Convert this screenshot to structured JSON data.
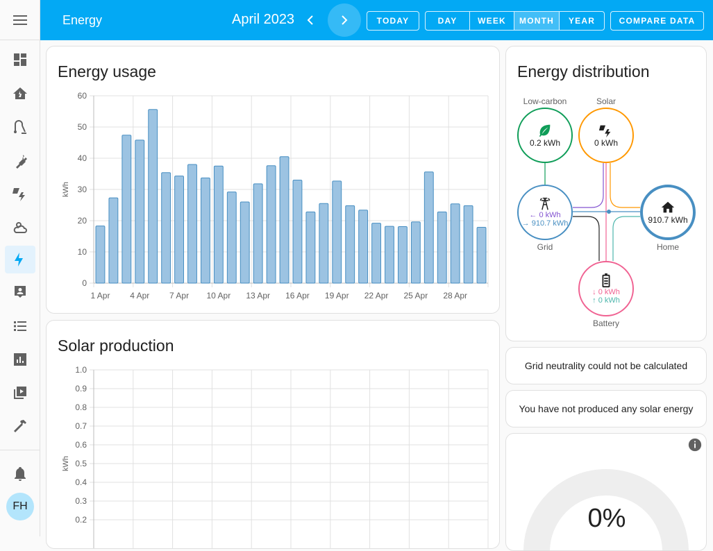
{
  "topbar": {
    "title": "Energy",
    "period": "April 2023",
    "today_label": "TODAY",
    "ranges": [
      "DAY",
      "WEEK",
      "MONTH",
      "YEAR"
    ],
    "selected_range": "MONTH",
    "compare_label": "COMPARE DATA"
  },
  "sidebar": {
    "items": [
      "menu-icon",
      "dashboard-icon",
      "home-lightning-icon",
      "vacuum-icon",
      "plug-icon",
      "solar-power-icon",
      "weather-icon",
      "energy-icon",
      "person-card-icon",
      "list-icon",
      "chart-icon",
      "media-icon",
      "hammer-icon",
      "bell-icon"
    ],
    "active": "energy-icon",
    "avatar": "FH"
  },
  "energy_usage": {
    "title": "Energy usage"
  },
  "solar_production": {
    "title": "Solar production"
  },
  "distribution": {
    "title": "Energy distribution",
    "low_carbon": {
      "label": "Low-carbon",
      "value": "0.2 kWh"
    },
    "solar": {
      "label": "Solar",
      "value": "0 kWh"
    },
    "grid": {
      "label": "Grid",
      "out": "0 kWh",
      "in": "910.7 kWh"
    },
    "home": {
      "label": "Home",
      "value": "910.7 kWh"
    },
    "battery": {
      "label": "Battery",
      "out": "0 kWh",
      "in": "0 kWh"
    },
    "colors": {
      "low_carbon": "#0f9d58",
      "solar": "#ff9800",
      "grid": "#488fc2",
      "home": "#488fc2",
      "battery": "#f06292",
      "return": "#8353d1",
      "battery_in": "#4db6ac"
    }
  },
  "grid_neutrality": {
    "text": "Grid neutrality could not be calculated"
  },
  "solar_message": {
    "text": "You have not produced any solar energy"
  },
  "gauge": {
    "value_text": "0%",
    "value": 0
  },
  "chart_data": [
    {
      "type": "bar",
      "title": "Energy usage",
      "ylabel": "kWh",
      "ylim": [
        0,
        60
      ],
      "yticks": [
        0,
        10,
        20,
        30,
        40,
        50,
        60
      ],
      "x": [
        "1 Apr",
        "2 Apr",
        "3 Apr",
        "4 Apr",
        "5 Apr",
        "6 Apr",
        "7 Apr",
        "8 Apr",
        "9 Apr",
        "10 Apr",
        "11 Apr",
        "12 Apr",
        "13 Apr",
        "14 Apr",
        "15 Apr",
        "16 Apr",
        "17 Apr",
        "18 Apr",
        "19 Apr",
        "20 Apr",
        "21 Apr",
        "22 Apr",
        "23 Apr",
        "24 Apr",
        "25 Apr",
        "26 Apr",
        "27 Apr",
        "28 Apr",
        "29 Apr",
        "30 Apr"
      ],
      "xtick_labels": [
        "1 Apr",
        "4 Apr",
        "7 Apr",
        "10 Apr",
        "13 Apr",
        "16 Apr",
        "19 Apr",
        "22 Apr",
        "25 Apr",
        "28 Apr"
      ],
      "values": [
        18.3,
        27.3,
        47.4,
        45.8,
        55.6,
        35.4,
        34.3,
        38.0,
        33.7,
        37.5,
        29.2,
        26.0,
        31.8,
        37.6,
        40.5,
        33.0,
        22.8,
        25.5,
        32.7,
        24.8,
        23.4,
        19.2,
        18.2,
        18.1,
        19.6,
        35.6,
        22.8,
        25.4,
        24.8,
        17.9
      ],
      "color": "#9cc3e2",
      "edge_color": "#488fc2"
    },
    {
      "type": "bar",
      "title": "Solar production",
      "ylabel": "kWh",
      "ylim": [
        0,
        1.0
      ],
      "yticks": [
        "0.2",
        "0.3",
        "0.4",
        "0.5",
        "0.6",
        "0.7",
        "0.8",
        "0.9",
        "1.0"
      ],
      "values": []
    }
  ]
}
